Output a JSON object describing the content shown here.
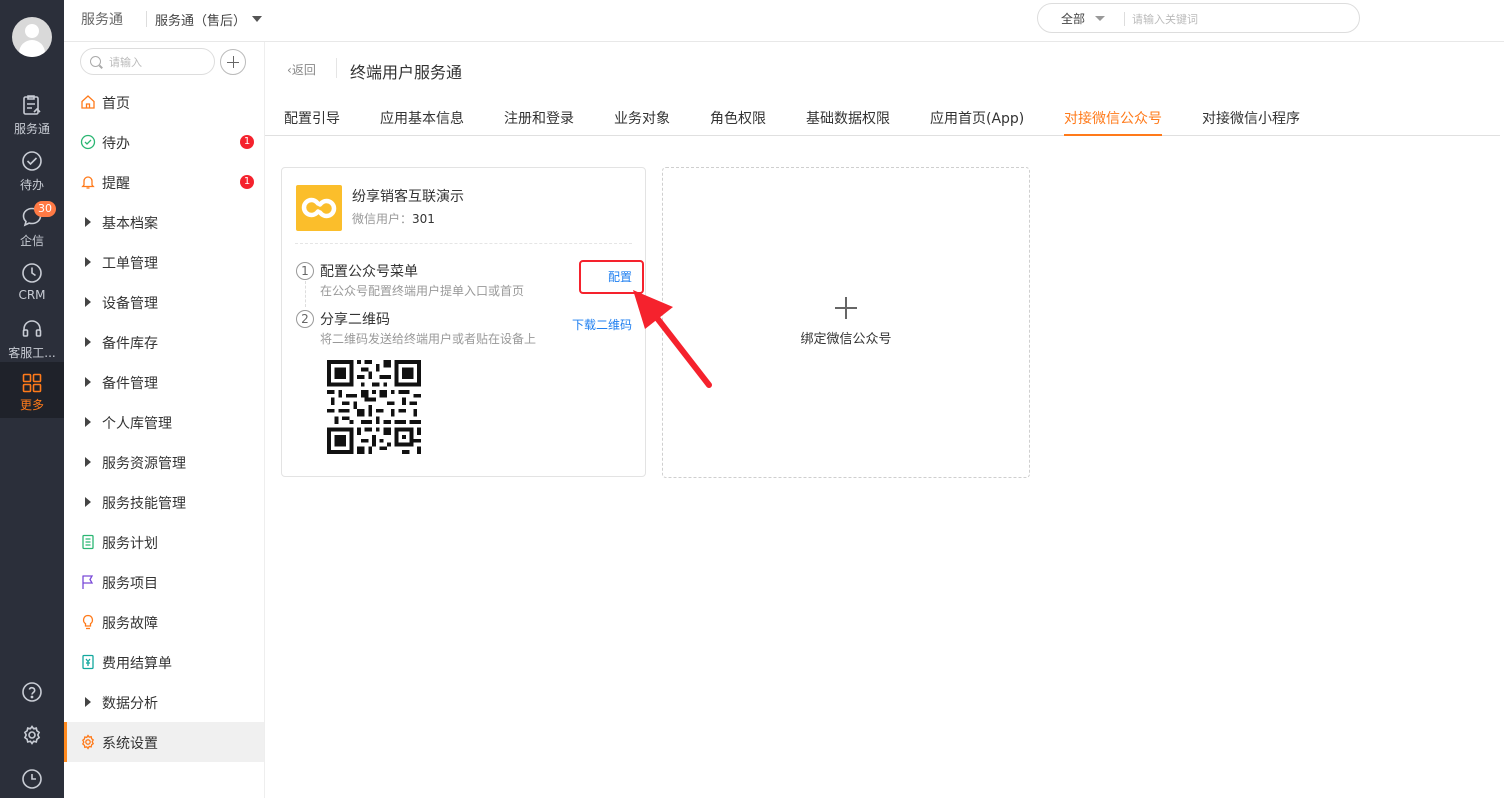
{
  "rail": {
    "items": [
      {
        "label": "服务通",
        "icon": "service-clipboard-icon"
      },
      {
        "label": "待办",
        "icon": "check-circle-icon"
      },
      {
        "label": "企信",
        "icon": "chat-bubble-icon",
        "badge": "30"
      },
      {
        "label": "CRM",
        "icon": "clock-icon"
      },
      {
        "label": "客服工...",
        "icon": "headset-icon"
      },
      {
        "label": "更多",
        "icon": "grid-icon",
        "active": true
      }
    ],
    "bottom_icons": [
      "help-icon",
      "settings-icon",
      "history-icon"
    ]
  },
  "topbar": {
    "app_title": "服务通",
    "app_select": "服务通（售后）",
    "search_scope": "全部",
    "search_placeholder": "请输入关键词"
  },
  "sidebar": {
    "search_placeholder": "请输入",
    "items": [
      {
        "label": "首页",
        "icon": "home-icon"
      },
      {
        "label": "待办",
        "icon": "check-circle-icon",
        "badge": "1"
      },
      {
        "label": "提醒",
        "icon": "bell-icon",
        "badge": "1"
      },
      {
        "label": "基本档案",
        "icon": "expand-triangle-icon"
      },
      {
        "label": "工单管理",
        "icon": "expand-triangle-icon"
      },
      {
        "label": "设备管理",
        "icon": "expand-triangle-icon"
      },
      {
        "label": "备件库存",
        "icon": "expand-triangle-icon"
      },
      {
        "label": "备件管理",
        "icon": "expand-triangle-icon"
      },
      {
        "label": "个人库管理",
        "icon": "expand-triangle-icon"
      },
      {
        "label": "服务资源管理",
        "icon": "expand-triangle-icon"
      },
      {
        "label": "服务技能管理",
        "icon": "expand-triangle-icon"
      },
      {
        "label": "服务计划",
        "icon": "list-doc-icon"
      },
      {
        "label": "服务项目",
        "icon": "flag-icon"
      },
      {
        "label": "服务故障",
        "icon": "bulb-icon"
      },
      {
        "label": "费用结算单",
        "icon": "bill-icon"
      },
      {
        "label": "数据分析",
        "icon": "expand-triangle-icon"
      },
      {
        "label": "系统设置",
        "icon": "gear-icon",
        "active": true
      }
    ]
  },
  "main": {
    "back_label": "返回",
    "title": "终端用户服务通",
    "tabs": [
      "配置引导",
      "应用基本信息",
      "注册和登录",
      "业务对象",
      "角色权限",
      "基础数据权限",
      "应用首页(App)",
      "对接微信公众号",
      "对接微信小程序"
    ],
    "active_tab": 7,
    "card": {
      "account_name": "纷享销客互联演示",
      "users_label": "微信用户：",
      "users_count": "301",
      "step1": {
        "num": "1",
        "title": "配置公众号菜单",
        "desc": "在公众号配置终端用户提单入口或首页",
        "action": "配置"
      },
      "step2": {
        "num": "2",
        "title": "分享二维码",
        "desc": "将二维码发送给终端用户或者贴在设备上",
        "action": "下载二维码"
      }
    },
    "add_card": {
      "label": "绑定微信公众号"
    }
  },
  "colors": {
    "accent": "#ff7a1a",
    "link": "#1f7ff0",
    "highlight": "#f5222d",
    "rail_bg": "#2b2f3a",
    "logo_bg": "#fbbe2b"
  }
}
